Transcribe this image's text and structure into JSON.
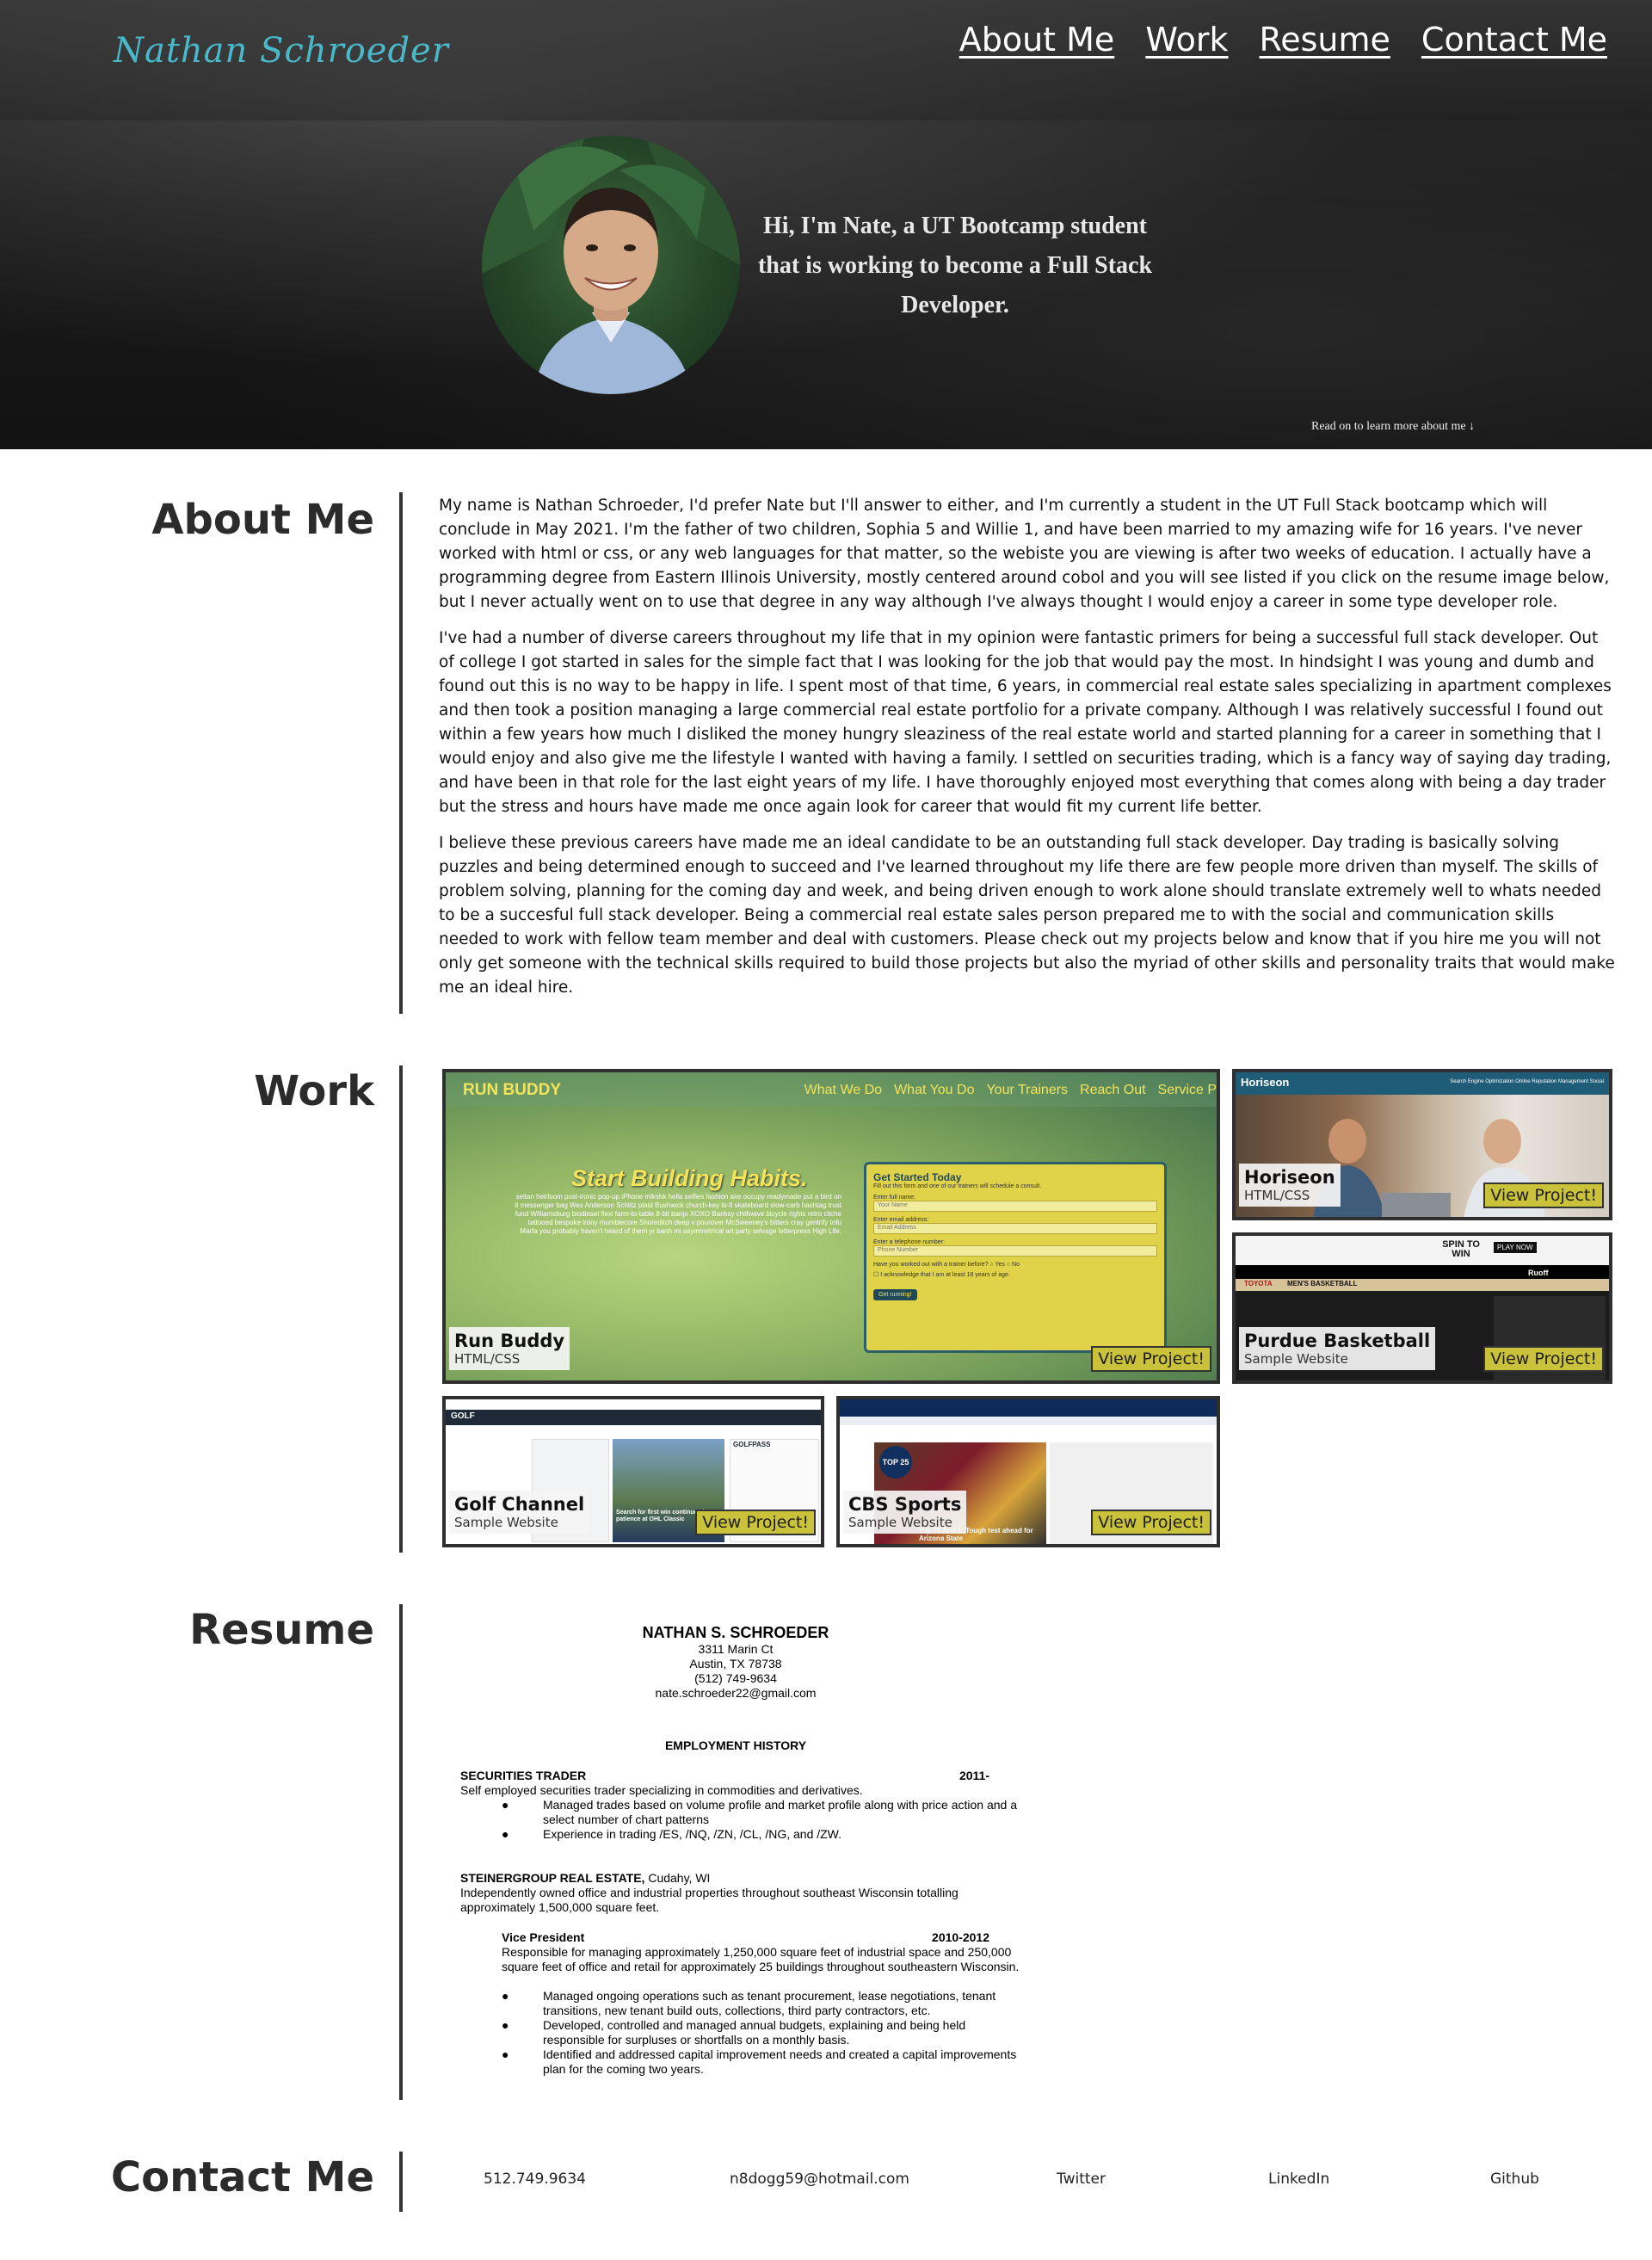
{
  "header": {
    "brand": "Nathan Schroeder",
    "nav": [
      "About Me",
      "Work",
      "Resume",
      "Contact Me"
    ],
    "hero_text": "Hi, I'm Nate, a UT Bootcamp student that is working to become a Full Stack Developer.",
    "read_on": "Read on to learn more about me ↓"
  },
  "about": {
    "title": "About Me",
    "paragraphs": [
      "My name is Nathan Schroeder, I'd prefer Nate but I'll answer to either, and I'm currently a student in the UT Full Stack bootcamp which will conclude in May 2021. I'm the father of two children, Sophia 5 and Willie 1, and have been married to my amazing wife for 16 years. I've never worked with html or css, or any web languages for that matter, so the webiste you are viewing is after two weeks of education. I actually have a programming degree from Eastern Illinois University, mostly centered around cobol and you will see listed if you click on the resume image below, but I never actually went on to use that degree in any way although I've always thought I would enjoy a career in some type developer role.",
      "I've had a number of diverse careers throughout my life that in my opinion were fantastic primers for being a successful full stack developer. Out of college I got started in sales for the simple fact that I was looking for the job that would pay the most. In hindsight I was young and dumb and found out this is no way to be happy in life. I spent most of that time, 6 years, in commercial real estate sales specializing in apartment complexes and then took a position managing a large commercial real estate portfolio for a private company. Although I was relatively successful I found out within a few years how much I disliked the money hungry sleaziness of the real estate world and started planning for a career in something that I would enjoy and also give me the lifestyle I wanted with having a family. I settled on securities trading, which is a fancy way of saying day trading, and have been in that role for the last eight years of my life. I have thoroughly enjoyed most everything that comes along with being a day trader but the stress and hours have made me once again look for career that would fit my current life better.",
      "I believe these previous careers have made me an ideal candidate to be an outstanding full stack developer. Day trading is basically solving puzzles and being determined enough to succeed and I've learned throughout my life there are few people more driven than myself. The skills of problem solving, planning for the coming day and week, and being driven enough to work alone should translate extremely well to whats needed to be a succesful full stack developer. Being a commercial real estate sales person prepared me to with the social and communication skills needed to work with fellow team member and deal with customers. Please check out my projects below and know that if you hire me you will not only get someone with the technical skills required to build those projects but also the myriad of other skills and personality traits that would make me an ideal hire."
    ]
  },
  "work": {
    "title": "Work",
    "view_label": "View Project!",
    "projects": [
      {
        "name": "Run Buddy",
        "sub": "HTML/CSS",
        "shot": {
          "brand": "RUN BUDDY",
          "nav": [
            "What We Do",
            "What You Do",
            "Your Trainers",
            "Reach Out",
            "Service P"
          ],
          "headline": "Start Building Habits.",
          "blurb": "seitan heirloom post-ironic pop-up iPhone mlkshk hella selfies fashion axe occupy readymade put a bird on it messenger bag Wes Anderson Schlitz plaid Bushwick church-key lo-fi skateboard slow-carb hashtag trust fund Williamsburg biodiesel flexi farm-to-table 8-bit banjo XOXO Banksy chillwave bicycle rights retro cliche tattooed bespoke irony mumblecore Shoreditch deep v pourover McSweeney's bitters cray gentrify tofu Marfa you probably haven't heard of them yr banh mi asymmetrical art party selvage letterpress High Life.",
          "form_title": "Get Started Today",
          "form_sub": "Fill out this form and one of our trainers will schedule a consult.",
          "fields": [
            {
              "label": "Enter full name:",
              "placeholder": "Your Name"
            },
            {
              "label": "Enter email address:",
              "placeholder": "Email Address"
            },
            {
              "label": "Enter a telephone number:",
              "placeholder": "Phone Number"
            }
          ],
          "question": "Have you worked out with a trainer before?",
          "yes": "Yes",
          "no": "No",
          "ack": "I acknowledge that I am at least 18 years of age.",
          "submit": "Get running!"
        }
      },
      {
        "name": "Horiseon",
        "sub": "HTML/CSS",
        "shot": {
          "brand": "Horiseon",
          "nav": "Search Engine Optimization    Online Reputation Management    Social"
        }
      },
      {
        "name": "Purdue Basketball",
        "sub": "Sample Website",
        "shot": {
          "banner": "SPIN TO WIN",
          "play": "PLAY NOW",
          "title": "MEN'S BASKETBALL",
          "brand": "TOYOTA",
          "sponsor": "Ruoff"
        }
      },
      {
        "name": "Golf Channel",
        "sub": "Sample Website",
        "shot": {
          "brand": "GOLF",
          "side": "GOLFPASS",
          "headline": "Search for first win continues in test patience at OHL Classic"
        }
      },
      {
        "name": "CBS Sports",
        "sub": "Sample Website",
        "shot": {
          "badge": "TOP 25",
          "headline": "Top 25 And 1: Tough test ahead for Arizona State"
        }
      }
    ]
  },
  "resume": {
    "title": "Resume",
    "name": "NATHAN S. SCHROEDER",
    "address1": "3311 Marin Ct",
    "address2": "Austin, TX 78738",
    "phone": "(512) 749-9634",
    "email": "nate.schroeder22@gmail.com",
    "section": "EMPLOYMENT HISTORY",
    "job1_title": "SECURITIES TRADER",
    "job1_year": "2011-",
    "job1_desc": "Self employed securities trader specializing in commodities and derivatives.",
    "job1_bullets": [
      "Managed trades based on volume profile and market profile along with price action and a select number of chart patterns",
      "Experience in trading /ES, /NQ, /ZN, /CL, /NG, and /ZW."
    ],
    "job2_company": "STEINERGROUP REAL ESTATE,",
    "job2_city": "Cudahy, WI",
    "job2_desc": "Independently owned office and industrial properties throughout southeast Wisconsin totalling approximately 1,500,000 square feet.",
    "job2_role": "Vice President",
    "job2_years": "2010-2012",
    "job2_role_desc": "Responsible for managing approximately 1,250,000 square feet of industrial space and 250,000 square feet of office and retail for approximately 25 buildings throughout southeastern Wisconsin.",
    "job2_bullets": [
      "Managed ongoing operations such as tenant procurement, lease negotiations, tenant transitions, new tenant build outs, collections, third party contractors, etc.",
      "Developed, controlled and managed annual budgets, explaining and being held responsible for surpluses or shortfalls on a monthly basis.",
      "Identified and addressed capital improvement needs and created a capital improvements plan for the coming two years."
    ],
    "bullet": "●"
  },
  "contact": {
    "title": "Contact Me",
    "phone": "512.749.9634",
    "email": "n8dogg59@hotmail.com",
    "twitter": "Twitter",
    "linkedin": "LinkedIn",
    "github": "Github"
  }
}
